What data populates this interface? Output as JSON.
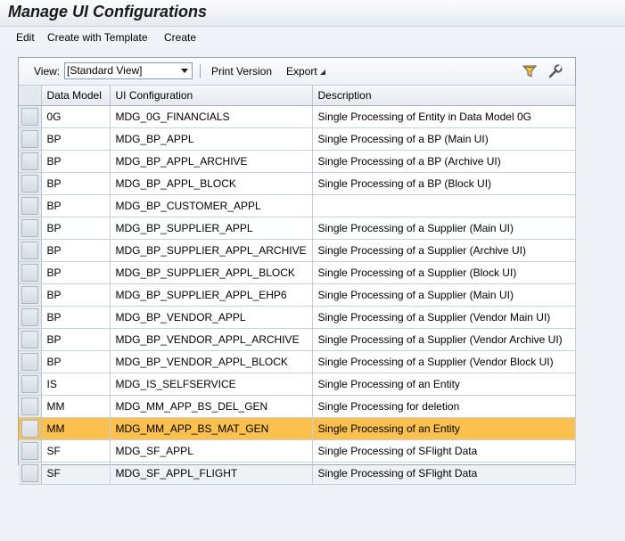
{
  "title": "Manage UI Configurations",
  "menu": [
    "Edit",
    "Create with Template",
    "Create"
  ],
  "toolbar": {
    "view_label": "View:",
    "view_value": "[Standard View]",
    "print_version": "Print Version",
    "export": "Export"
  },
  "columns": [
    "Data Model",
    "UI Configuration",
    "Description"
  ],
  "rows": [
    {
      "model": "0G",
      "config": "MDG_0G_FINANCIALS",
      "desc": "Single Processing of Entity in Data Model 0G"
    },
    {
      "model": "BP",
      "config": "MDG_BP_APPL",
      "desc": "Single Processing of a BP (Main UI)"
    },
    {
      "model": "BP",
      "config": "MDG_BP_APPL_ARCHIVE",
      "desc": "Single Processing of a BP (Archive UI)"
    },
    {
      "model": "BP",
      "config": "MDG_BP_APPL_BLOCK",
      "desc": "Single Processing of a BP (Block UI)"
    },
    {
      "model": "BP",
      "config": "MDG_BP_CUSTOMER_APPL",
      "desc": ""
    },
    {
      "model": "BP",
      "config": "MDG_BP_SUPPLIER_APPL",
      "desc": "Single Processing of a Supplier (Main UI)"
    },
    {
      "model": "BP",
      "config": "MDG_BP_SUPPLIER_APPL_ARCHIVE",
      "desc": "Single Processing of a Supplier (Archive UI)"
    },
    {
      "model": "BP",
      "config": "MDG_BP_SUPPLIER_APPL_BLOCK",
      "desc": "Single Processing of a Supplier (Block UI)"
    },
    {
      "model": "BP",
      "config": "MDG_BP_SUPPLIER_APPL_EHP6",
      "desc": "Single Processing of a Supplier (Main UI)"
    },
    {
      "model": "BP",
      "config": "MDG_BP_VENDOR_APPL",
      "desc": "Single Processing of a Supplier (Vendor Main UI)"
    },
    {
      "model": "BP",
      "config": "MDG_BP_VENDOR_APPL_ARCHIVE",
      "desc": "Single Processing of a Supplier (Vendor Archive UI)"
    },
    {
      "model": "BP",
      "config": "MDG_BP_VENDOR_APPL_BLOCK",
      "desc": "Single Processing of a Supplier (Vendor Block UI)"
    },
    {
      "model": "IS",
      "config": "MDG_IS_SELFSERVICE",
      "desc": "Single Processing of an Entity"
    },
    {
      "model": "MM",
      "config": "MDG_MM_APP_BS_DEL_GEN",
      "desc": "Single Processing for deletion"
    },
    {
      "model": "MM",
      "config": "MDG_MM_APP_BS_MAT_GEN",
      "desc": "Single Processing of an Entity",
      "selected": true
    },
    {
      "model": "SF",
      "config": "MDG_SF_APPL",
      "desc": "Single Processing of SFlight Data"
    },
    {
      "model": "SF",
      "config": "MDG_SF_APPL_FLIGHT",
      "desc": "Single Processing of SFlight Data"
    }
  ],
  "colors": {
    "selected_row": "#fcc04e",
    "background": "#eef2f7"
  }
}
